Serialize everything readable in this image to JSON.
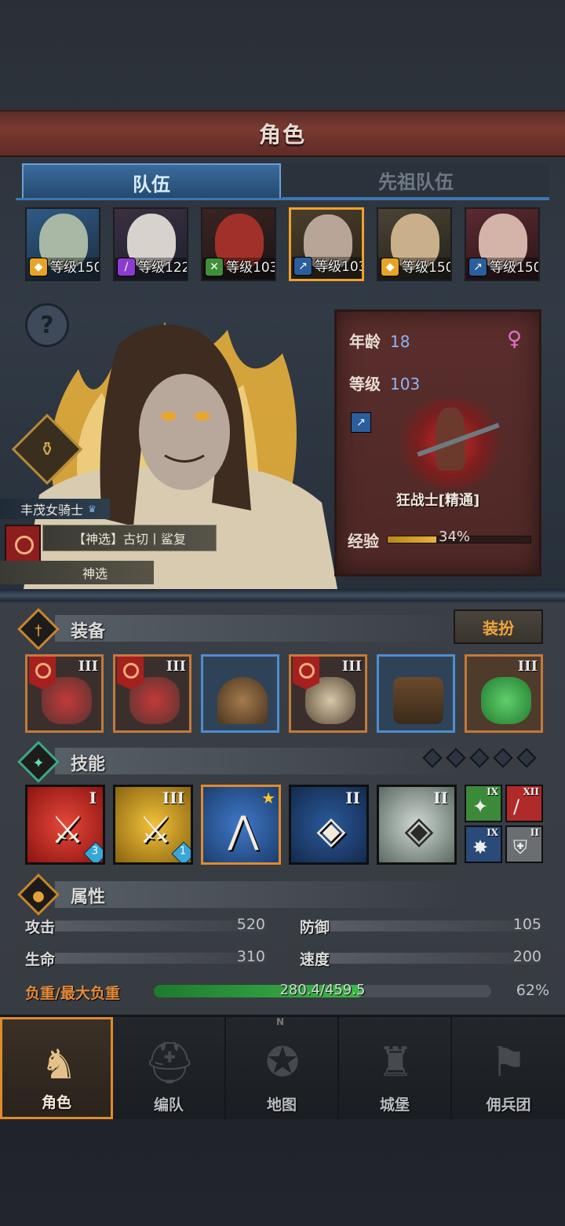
{
  "header": {
    "title": "角色"
  },
  "tabs": [
    {
      "label": "队伍"
    },
    {
      "label": "先祖队伍"
    }
  ],
  "heroes": [
    {
      "level": "等级150",
      "class_icon": "shield-icon"
    },
    {
      "level": "等级122",
      "class_icon": "staff-icon"
    },
    {
      "level": "等级103",
      "class_icon": "crossed-swords-icon"
    },
    {
      "level": "等级103",
      "class_icon": "sword-icon"
    },
    {
      "level": "等级150",
      "class_icon": "shield-icon"
    },
    {
      "level": "等级150",
      "class_icon": "sword-icon"
    }
  ],
  "character": {
    "help": "?",
    "name": "丰茂女骑士",
    "trait": "【神选】古切丨鲨复",
    "trait2": "神选",
    "age_label": "年龄",
    "age": "18",
    "level_label": "等级",
    "level": "103",
    "gender": "♀",
    "class_name": "狂战士[精通]",
    "exp_label": "经验",
    "exp_pct": "34%",
    "exp_fraction": 0.34
  },
  "equipment": {
    "title": "装备",
    "dress_label": "装扮",
    "slots": [
      {
        "rank": "III",
        "color": "orange",
        "flag": true,
        "name": "weapon-slot"
      },
      {
        "rank": "III",
        "color": "orange",
        "flag": true,
        "name": "offhand-slot"
      },
      {
        "rank": "",
        "color": "blue",
        "flag": false,
        "name": "helmet-slot"
      },
      {
        "rank": "III",
        "color": "orange",
        "flag": true,
        "name": "armor-slot"
      },
      {
        "rank": "",
        "color": "blue",
        "flag": false,
        "name": "boots-slot"
      },
      {
        "rank": "III",
        "color": "orange",
        "flag": false,
        "name": "trinket-slot"
      }
    ]
  },
  "skills": {
    "title": "技能",
    "items": [
      {
        "rank": "I",
        "gem": "3",
        "bg": "red"
      },
      {
        "rank": "III",
        "gem": "1",
        "bg": "yellow"
      },
      {
        "rank": "★",
        "gem": "",
        "bg": "blue-orange"
      },
      {
        "rank": "II",
        "gem": "",
        "bg": "darkblue"
      },
      {
        "rank": "II",
        "gem": "",
        "bg": "grey"
      }
    ],
    "passives": [
      {
        "rank": "IX"
      },
      {
        "rank": "XII"
      },
      {
        "rank": "IX"
      },
      {
        "rank": "II"
      }
    ]
  },
  "attributes": {
    "title": "属性",
    "attack_label": "攻击",
    "attack": "520",
    "defense_label": "防御",
    "defense": "105",
    "hp_label": "生命",
    "hp": "310",
    "speed_label": "速度",
    "speed": "200",
    "weight_label": "负重/最大负重",
    "weight": "280.4/459.5",
    "weight_pct": "62%",
    "weight_fraction": 0.62
  },
  "nav": [
    {
      "label": "角色",
      "active": true
    },
    {
      "label": "编队",
      "active": false
    },
    {
      "label": "地图",
      "active": false
    },
    {
      "label": "城堡",
      "active": false
    },
    {
      "label": "佣兵团",
      "active": false
    }
  ],
  "compass_north": "N",
  "colors": {
    "accent": "#e08a2b",
    "tab_active": "#3a6b9c",
    "header": "#7a3a31",
    "exp": "#e6b23a",
    "weight": "#3fb84a"
  }
}
